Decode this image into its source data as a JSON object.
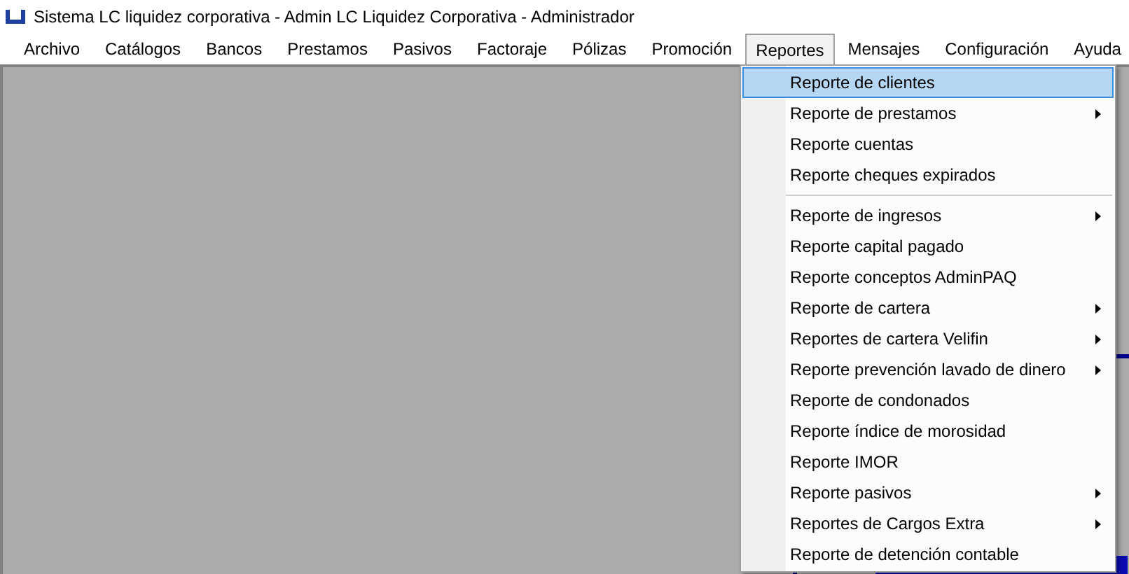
{
  "window": {
    "title": "Sistema LC liquidez corporativa - Admin LC Liquidez Corporativa - Administrador"
  },
  "menu_bar": [
    {
      "label": "Archivo",
      "selected": false
    },
    {
      "label": "Catálogos",
      "selected": false
    },
    {
      "label": "Bancos",
      "selected": false
    },
    {
      "label": "Prestamos",
      "selected": false
    },
    {
      "label": "Pasivos",
      "selected": false
    },
    {
      "label": "Factoraje",
      "selected": false
    },
    {
      "label": "Pólizas",
      "selected": false
    },
    {
      "label": "Promoción",
      "selected": false
    },
    {
      "label": "Reportes",
      "selected": true
    },
    {
      "label": "Mensajes",
      "selected": false
    },
    {
      "label": "Configuración",
      "selected": false
    },
    {
      "label": "Ayuda",
      "selected": false
    }
  ],
  "dropdown": [
    {
      "kind": "item",
      "label": "Reporte de clientes",
      "selected": true,
      "submenu": false
    },
    {
      "kind": "item",
      "label": "Reporte de prestamos",
      "selected": false,
      "submenu": true
    },
    {
      "kind": "item",
      "label": "Reporte cuentas",
      "selected": false,
      "submenu": false
    },
    {
      "kind": "item",
      "label": "Reporte cheques expirados",
      "selected": false,
      "submenu": false
    },
    {
      "kind": "separator"
    },
    {
      "kind": "item",
      "label": "Reporte de ingresos",
      "selected": false,
      "submenu": true
    },
    {
      "kind": "item",
      "label": "Reporte capital pagado",
      "selected": false,
      "submenu": false
    },
    {
      "kind": "item",
      "label": "Reporte conceptos AdminPAQ",
      "selected": false,
      "submenu": false
    },
    {
      "kind": "item",
      "label": "Reporte de cartera",
      "selected": false,
      "submenu": true
    },
    {
      "kind": "item",
      "label": "Reportes de cartera Velifin",
      "selected": false,
      "submenu": true
    },
    {
      "kind": "item",
      "label": "Reporte prevención lavado de dinero",
      "selected": false,
      "submenu": true
    },
    {
      "kind": "item",
      "label": "Reporte de condonados",
      "selected": false,
      "submenu": false
    },
    {
      "kind": "item",
      "label": "Reporte índice de morosidad",
      "selected": false,
      "submenu": false
    },
    {
      "kind": "item",
      "label": "Reporte IMOR",
      "selected": false,
      "submenu": false
    },
    {
      "kind": "item",
      "label": "Reporte pasivos",
      "selected": false,
      "submenu": true
    },
    {
      "kind": "item",
      "label": "Reportes de Cargos Extra",
      "selected": false,
      "submenu": true
    },
    {
      "kind": "item",
      "label": "Reporte de detención contable",
      "selected": false,
      "submenu": false
    }
  ]
}
